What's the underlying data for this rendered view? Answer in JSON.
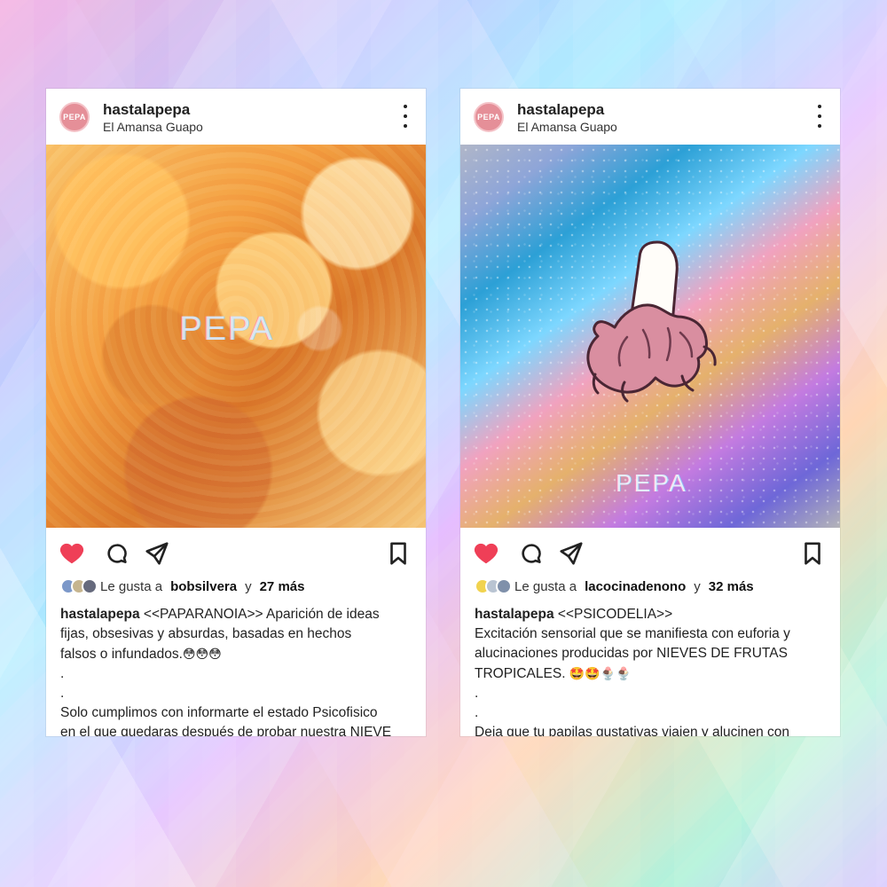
{
  "posts": [
    {
      "header": {
        "avatar_text": "PEPA",
        "username": "hastalapepa",
        "location": "El Amansa Guapo"
      },
      "media": {
        "watermark": "PEPA",
        "alt": "ice cream texture"
      },
      "likes": {
        "prefix": "Le gusta a",
        "liker": "bobsilvera",
        "middle": "y",
        "count": "27 más"
      },
      "caption": {
        "user": "hastalapepa",
        "line1": "<<PAPARANOIA>> Aparición de ideas",
        "line2": "fijas, obsesivas y absurdas, basadas en hechos",
        "line3": "falsos o infundados.",
        "emojis": "😳😳😳",
        "dot1": ".",
        "dot2": ".",
        "line4": "Solo cumplimos con informarte el estado Psicofisico",
        "line5": "en el que quedaras después de probar nuestra NIEVE"
      }
    },
    {
      "header": {
        "avatar_text": "PEPA",
        "username": "hastalapepa",
        "location": "El Amansa Guapo"
      },
      "media": {
        "watermark": "PEPA",
        "alt": "psychedelic banana"
      },
      "likes": {
        "prefix": "Le gusta a",
        "liker": "lacocinadenono",
        "middle": "y",
        "count": "32 más"
      },
      "caption": {
        "user": "hastalapepa",
        "line1": "<<PSICODELIA>>",
        "line2": "Excitación sensorial que se manifiesta con euforia y",
        "line3": "alucinaciones producidas por NIEVES DE FRUTAS",
        "line4": "TROPICALES.",
        "emojis": "🤩🤩🍨🍨",
        "dot1": ".",
        "dot2": ".",
        "line5": "Deja que tu papilas gustativas viajen y alucinen con"
      }
    }
  ],
  "colors": {
    "heart": "#ef3f57",
    "text": "#222222",
    "avatar": "#e58f98"
  },
  "icons": {
    "like": "heart-icon",
    "comment": "comment-icon",
    "share": "share-icon",
    "save": "save-icon",
    "menu": "more-icon"
  }
}
